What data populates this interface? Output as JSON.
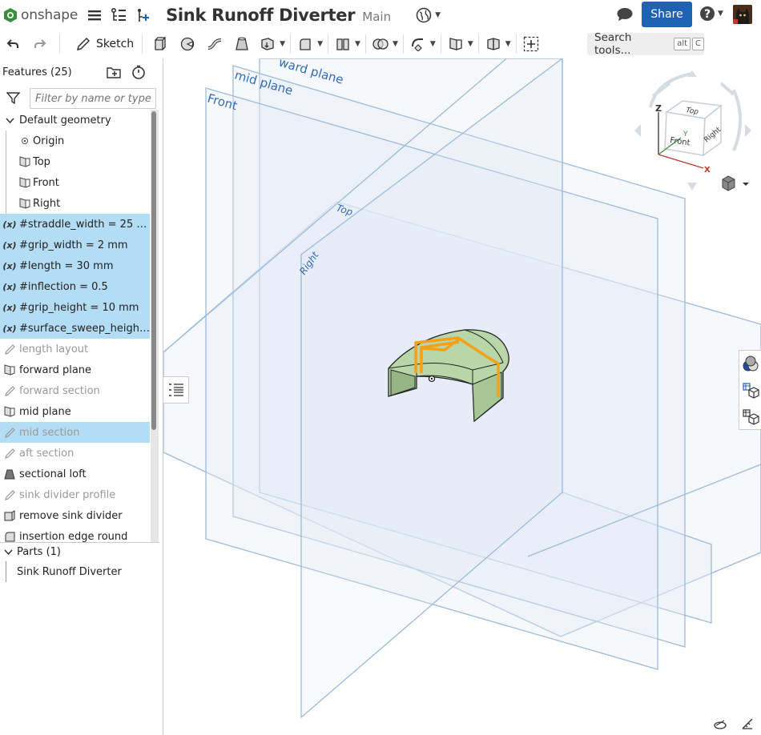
{
  "app": {
    "logo_text": "onshape",
    "document_title": "Sink Runoff Diverter",
    "branch": "Main",
    "share_label": "Share"
  },
  "toolbar": {
    "sketch_label": "Sketch",
    "search_label": "Search tools...",
    "search_shortcut_1": "alt",
    "search_shortcut_2": "C"
  },
  "features": {
    "header": "Features (25)",
    "filter_placeholder": "Filter by name or type",
    "items": [
      {
        "label": "Default geometry",
        "type": "group"
      },
      {
        "label": "Origin",
        "type": "origin"
      },
      {
        "label": "Top",
        "type": "plane"
      },
      {
        "label": "Front",
        "type": "plane"
      },
      {
        "label": "Right",
        "type": "plane"
      },
      {
        "label": "#straddle_width = 25 m...",
        "type": "variable",
        "selected": true
      },
      {
        "label": "#grip_width = 2 mm",
        "type": "variable",
        "selected": true
      },
      {
        "label": "#length = 30 mm",
        "type": "variable",
        "selected": true
      },
      {
        "label": "#inflection = 0.5",
        "type": "variable",
        "selected": true
      },
      {
        "label": "#grip_height = 10 mm",
        "type": "variable",
        "selected": true
      },
      {
        "label": "#surface_sweep_height...",
        "type": "variable",
        "selected": true
      },
      {
        "label": "length layout",
        "type": "sketch",
        "dim": true
      },
      {
        "label": "forward plane",
        "type": "plane"
      },
      {
        "label": "forward section",
        "type": "sketch",
        "dim": true
      },
      {
        "label": "mid plane",
        "type": "plane"
      },
      {
        "label": "mid section",
        "type": "sketch",
        "dim": true,
        "selected": true
      },
      {
        "label": "aft section",
        "type": "sketch",
        "dim": true
      },
      {
        "label": "sectional loft",
        "type": "loft"
      },
      {
        "label": "sink divider profile",
        "type": "sketch",
        "dim": true
      },
      {
        "label": "remove sink divider",
        "type": "extrude"
      },
      {
        "label": "insertion edge round",
        "type": "fillet"
      }
    ]
  },
  "parts": {
    "header": "Parts (1)",
    "items": [
      "Sink Runoff Diverter"
    ]
  },
  "viewport": {
    "plane_labels": {
      "forward": "ward plane",
      "mid": "mid plane",
      "front": "Front",
      "top": "Top",
      "right": "Right"
    },
    "view_cube": {
      "top": "Top",
      "front": "Front",
      "right": "Right",
      "axis_z": "Z",
      "axis_y": "Y",
      "axis_x": "X"
    }
  },
  "colors": {
    "accent": "#1f61b3",
    "selection": "#b3dcf5",
    "plane_stroke": "#9bbbdb",
    "plane_label": "#2f6db5",
    "part_fill": "#b9d6a9",
    "sketch_orange": "#f2a11a"
  }
}
